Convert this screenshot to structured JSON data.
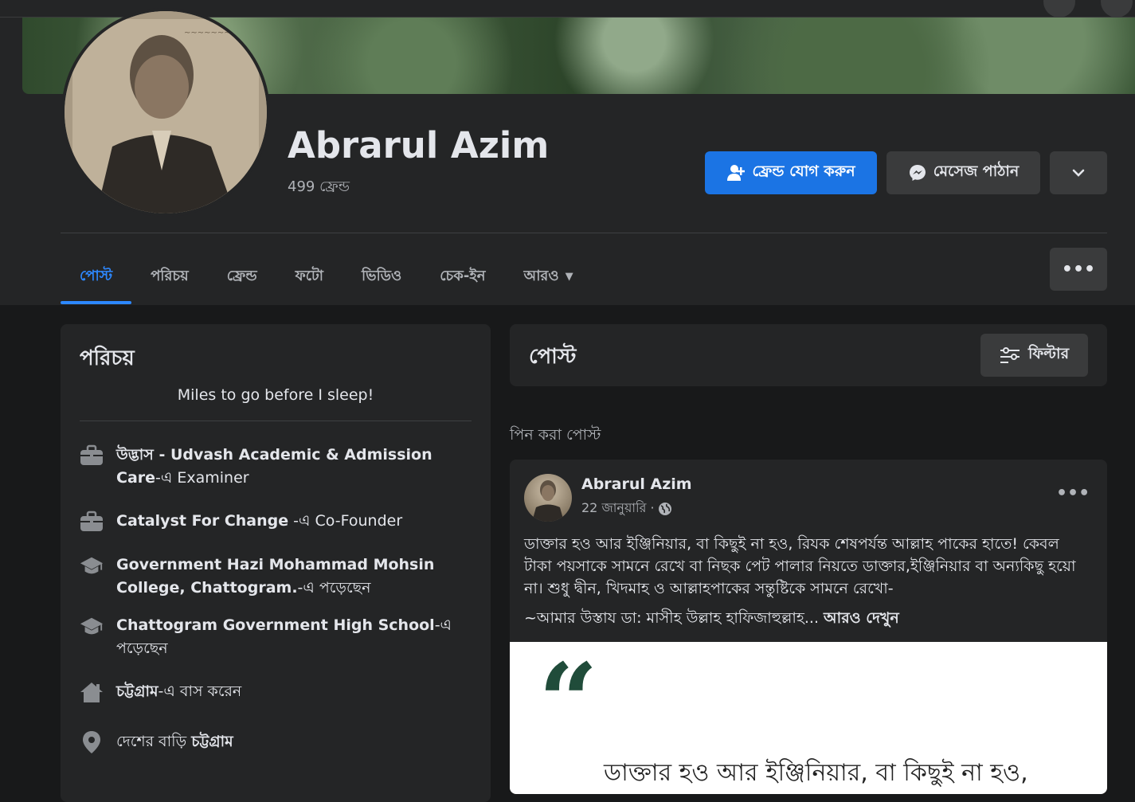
{
  "profile": {
    "name": "Abrarul Azim",
    "friends_count": "499 ফ্রেন্ড"
  },
  "actions": {
    "add_friend": "ফ্রেন্ড যোগ করুন",
    "message": "মেসেজ পাঠান"
  },
  "tabs": [
    {
      "label": "পোস্ট",
      "active": true
    },
    {
      "label": "পরিচয়"
    },
    {
      "label": "ফ্রেন্ড"
    },
    {
      "label": "ফটো"
    },
    {
      "label": "ভিডিও"
    },
    {
      "label": "চেক-ইন"
    },
    {
      "label": "আরও"
    }
  ],
  "intro": {
    "title": "পরিচয়",
    "bio": "Miles to go before I sleep!",
    "items": [
      {
        "icon": "briefcase-icon",
        "bold": "উদ্ভাস - Udvash Academic & Admission Care",
        "rest": "-এ Examiner"
      },
      {
        "icon": "briefcase-icon",
        "bold": "Catalyst For Change",
        "rest": " -এ Co-Founder"
      },
      {
        "icon": "graduation-cap-icon",
        "bold": "Government Hazi Mohammad Mohsin College, Chattogram.",
        "rest": "-এ পড়েছেন"
      },
      {
        "icon": "graduation-cap-icon",
        "bold": "Chattogram Government High School",
        "rest": "-এ পড়েছেন"
      },
      {
        "icon": "home-icon",
        "bold": "চট্টগ্রাম",
        "rest": "-এ বাস করেন"
      },
      {
        "icon": "location-pin-icon",
        "pre": "দেশের বাড়ি ",
        "bold": "চট্টগ্রাম",
        "rest": ""
      }
    ]
  },
  "posts_section": {
    "title": "পোস্ট",
    "filter_label": "ফিল্টার",
    "pinned_label": "পিন করা পোস্ট"
  },
  "post": {
    "author": "Abrarul Azim",
    "date": "22 জানুয়ারি ·",
    "text": "ডাক্তার হও আর ইঞ্জিনিয়ার, বা কিছুই না হও, রিযক শেষপর্যন্ত আল্লাহ পাকের হাতে! কেবল টাকা পয়সাকে সামনে রেখে বা নিছক পেট পালার নিয়তে ডাক্তার,ইঞ্জিনিয়ার বা অন্যকিছু হয়ো না। শুধু দ্বীন, খিদমাহ ও আল্লাহপাকের সন্তুষ্টিকে সামনে রেখো-",
    "text2": "~আমার উস্তায ডা: মাসীহ উল্লাহ হাফিজাহুল্লাহ...",
    "see_more": "আরও দেখুন",
    "image_text": "ডাক্তার হও আর ইঞ্জিনিয়ার, বা কিছুই না হও,"
  },
  "colors": {
    "accent": "#2d88ff",
    "button_blue": "#1b74e4",
    "surface": "#242526",
    "background": "#18191a"
  }
}
